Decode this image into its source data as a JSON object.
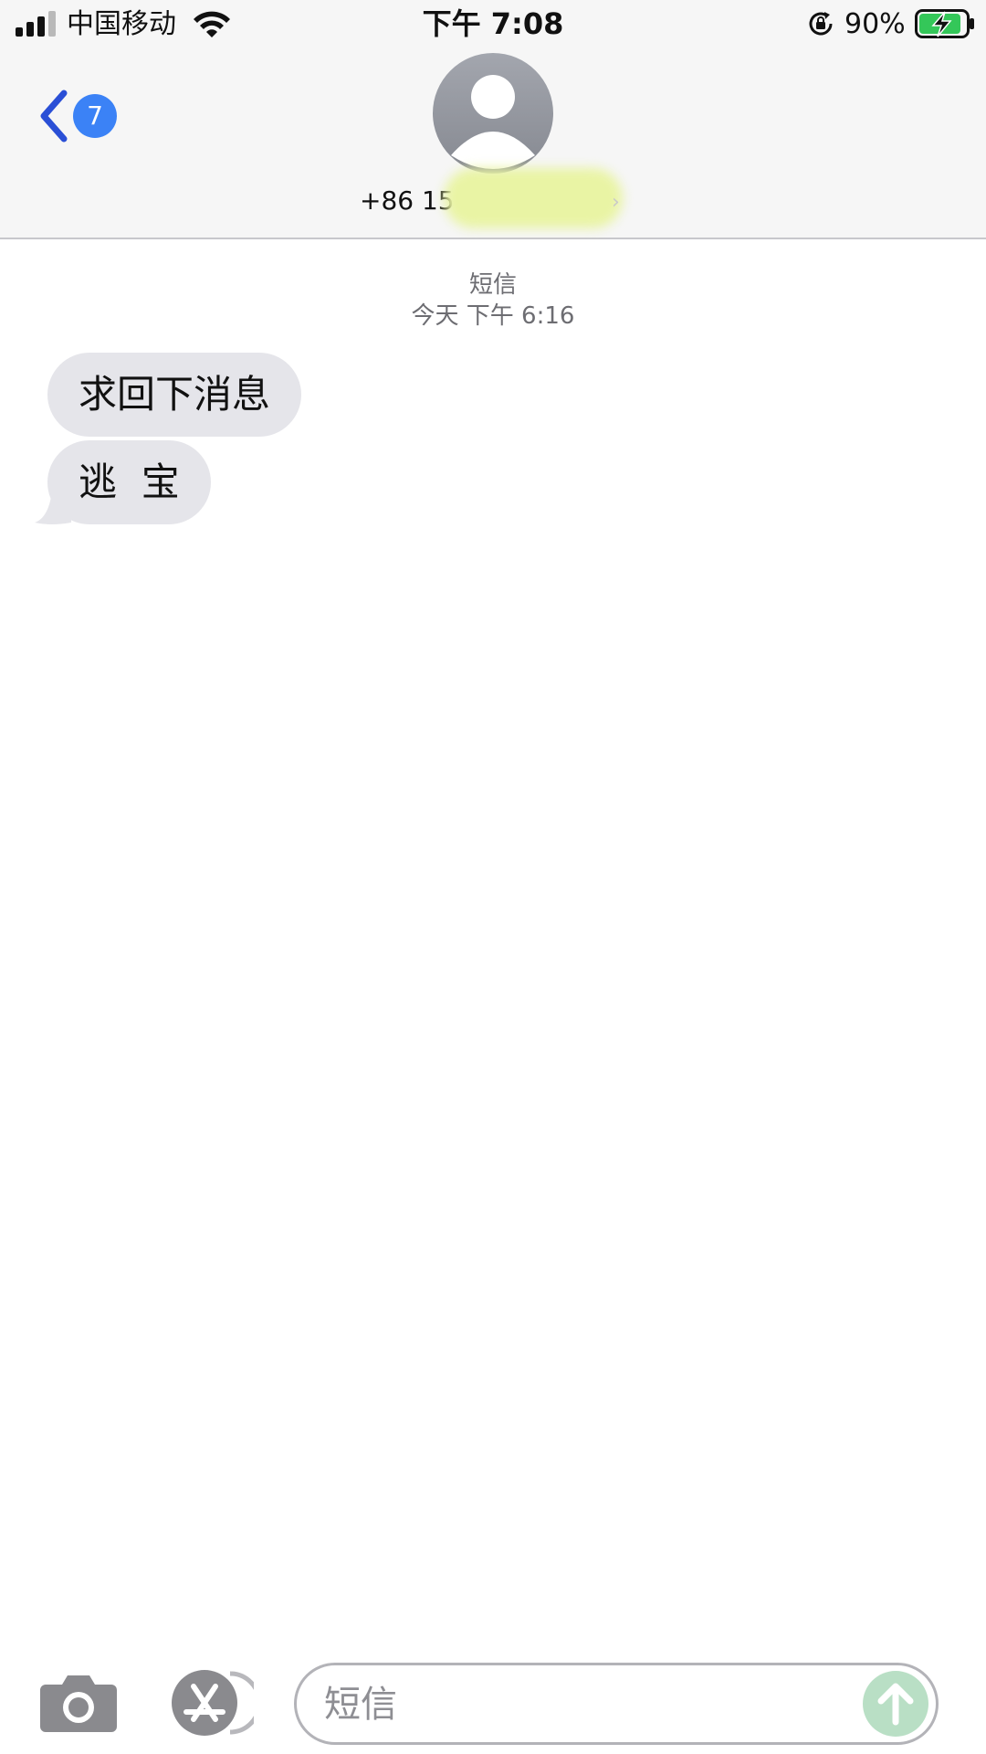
{
  "status_bar": {
    "carrier": "中国移动",
    "time": "下午 7:08",
    "battery_percent": "90%",
    "battery_level": 0.9,
    "icons": [
      "signal-icon",
      "wifi-icon",
      "orientation-lock-icon",
      "battery-charging-icon"
    ]
  },
  "nav": {
    "back_badge": "7",
    "contact_number": "+86 15",
    "icons": [
      "chevron-left-icon",
      "avatar-icon",
      "chevron-right-icon"
    ]
  },
  "conversation": {
    "service_label": "短信",
    "timestamp": "今天 下午 6:16",
    "messages": [
      {
        "text": "求回下消息"
      },
      {
        "text": "逃  宝"
      }
    ]
  },
  "input_bar": {
    "placeholder": "短信",
    "icons": [
      "camera-icon",
      "app-store-icon",
      "send-arrow-icon"
    ]
  },
  "colors": {
    "accent": "#3b82f6",
    "bubble": "#e5e5ea",
    "header_bg": "#f6f6f6",
    "battery_green": "#34c759",
    "send_disabled": "#b9dfc5"
  }
}
